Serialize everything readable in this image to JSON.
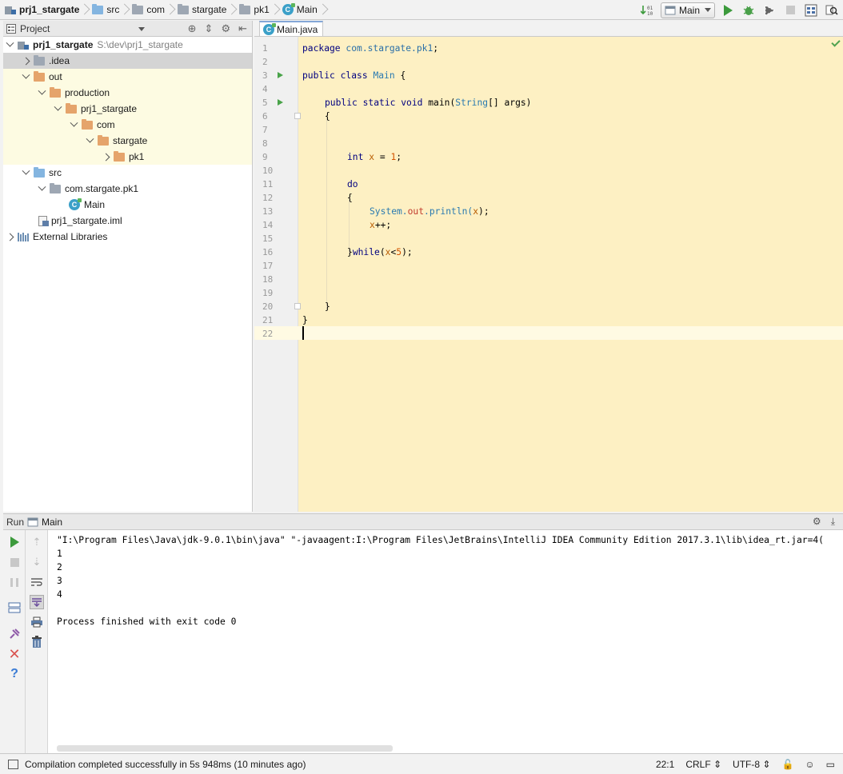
{
  "navbar": {
    "crumbs": [
      "prj1_stargate",
      "src",
      "com",
      "stargate",
      "pk1",
      "Main"
    ]
  },
  "toolbar": {
    "run_config": "Main"
  },
  "project_panel": {
    "title": "Project",
    "tree": [
      {
        "label": "prj1_stargate",
        "path": "S:\\dev\\prj1_stargate"
      },
      {
        "label": ".idea"
      },
      {
        "label": "out"
      },
      {
        "label": "production"
      },
      {
        "label": "prj1_stargate"
      },
      {
        "label": "com"
      },
      {
        "label": "stargate"
      },
      {
        "label": "pk1"
      },
      {
        "label": "src"
      },
      {
        "label": "com.stargate.pk1"
      },
      {
        "label": "Main"
      },
      {
        "label": "prj1_stargate.iml"
      },
      {
        "label": "External Libraries"
      }
    ]
  },
  "editor": {
    "tab_label": "Main.java",
    "line_numbers": [
      "1",
      "2",
      "3",
      "4",
      "5",
      "6",
      "7",
      "8",
      "9",
      "10",
      "11",
      "12",
      "13",
      "14",
      "15",
      "16",
      "17",
      "18",
      "19",
      "20",
      "21",
      "22"
    ],
    "code": {
      "l1_kw": "package",
      "l1_pk": "com.stargate.pk1",
      "l1_end": ";",
      "l3_kw": "public class",
      "l3_cls": "Main",
      "l3_end": "{",
      "l5_kw": "public static void",
      "l5_name": "main(",
      "l5_type": "String",
      "l5_end": "[] args)",
      "l6": "{",
      "l9_kw": "int",
      "l9_var": "x",
      "l9_eq": "=",
      "l9_num": "1",
      "l9_end": ";",
      "l11_kw": "do",
      "l12": "{",
      "l13_cls": "System.",
      "l13_fld": "out",
      "l13_m": ".println(",
      "l13_var": "x",
      "l13_end": ");",
      "l14_var": "x",
      "l14_end": "++;",
      "l16_a": "}",
      "l16_kw": "while",
      "l16_b": "(",
      "l16_var": "x",
      "l16_c": "<",
      "l16_num": "5",
      "l16_d": ");",
      "l20": "}",
      "l21": "}"
    }
  },
  "run_panel": {
    "label": "Run",
    "tab": "Main",
    "console": [
      "\"I:\\Program Files\\Java\\jdk-9.0.1\\bin\\java\" \"-javaagent:I:\\Program Files\\JetBrains\\IntelliJ IDEA Community Edition 2017.3.1\\lib\\idea_rt.jar=4(",
      "1",
      "2",
      "3",
      "4",
      "",
      "Process finished with exit code 0"
    ]
  },
  "status_bar": {
    "message": "Compilation completed successfully in 5s 948ms (10 minutes ago)",
    "position": "22:1",
    "line_sep": "CRLF",
    "encoding": "UTF-8"
  },
  "colors": {
    "code_bg": "#fdf0c3",
    "keyword": "#000080",
    "run_green": "#3c9a3c"
  }
}
